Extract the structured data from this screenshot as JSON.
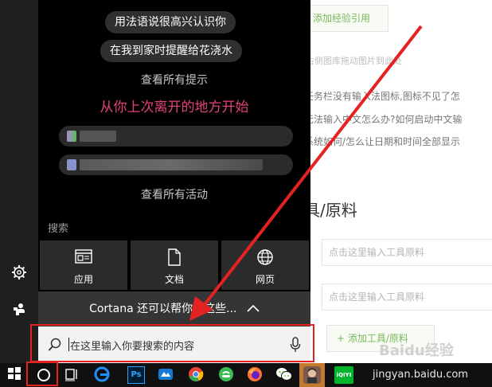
{
  "panel": {
    "suggestions": [
      "用法语说很高兴认识你",
      "在我到家时提醒给花浇水"
    ],
    "show_all_tips": "查看所有提示",
    "resume_heading": "从你上次离开的地方开始",
    "show_all_activity": "查看所有活动",
    "search_section_label": "搜索",
    "tiles": [
      {
        "label": "应用",
        "icon": "apps-icon"
      },
      {
        "label": "文档",
        "icon": "document-icon"
      },
      {
        "label": "网页",
        "icon": "globe-icon"
      }
    ],
    "cortana_text": "Cortana 还可以帮你做这些...",
    "search_placeholder": "在这里输入你要搜索的内容"
  },
  "background_page": {
    "ref_button": "添加经验引用",
    "drag_hint": "右侧图库拖动图片到此处",
    "links": [
      "任务栏没有输入法图标,图标不见了怎",
      "无法输入中文怎么办?如何启动中文输",
      "系统如何/怎么让日期和时间全部显示"
    ],
    "section_title": "具/原料",
    "tool_placeholder_1": "点击这里输入工具原料",
    "tool_placeholder_2": "点击这里输入工具原料",
    "add_tool_button": "+ 添加工具/原料",
    "watermark": "Baidu经验",
    "watermark_url": "jingyan.baidu.com"
  },
  "taskbar": {
    "icons": [
      "windows-start-icon",
      "cortana-circle-icon",
      "task-view-icon",
      "edge-icon",
      "photoshop-icon",
      "app-icon",
      "chrome-icon",
      "green-app-icon",
      "firefox-icon",
      "wechat-icon",
      "avatar-app-icon",
      "iqiyi-icon"
    ],
    "ps_label": "Ps",
    "iqiyi_label": "iQIYI"
  },
  "colors": {
    "accent_pink": "#e5407b",
    "annotation_red": "#e52222",
    "panel_bg": "#000000",
    "tile_bg": "#2b2b2b"
  }
}
